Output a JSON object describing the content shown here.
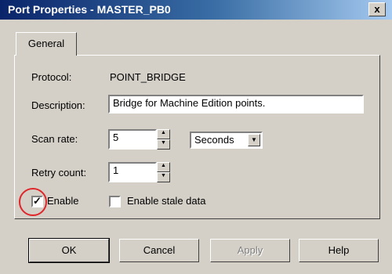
{
  "window": {
    "title": "Port Properties - MASTER_PB0",
    "close_label": "x"
  },
  "tabs": [
    {
      "label": "General"
    }
  ],
  "general": {
    "protocol_label": "Protocol:",
    "protocol_value": "POINT_BRIDGE",
    "description_label": "Description:",
    "description_value": "Bridge for Machine Edition points.",
    "scan_rate_label": "Scan rate:",
    "scan_rate_value": "5",
    "scan_rate_unit": "Seconds",
    "retry_count_label": "Retry count:",
    "retry_count_value": "1",
    "enable_label": "Enable",
    "enable_checked": true,
    "stale_label": "Enable stale data",
    "stale_checked": false
  },
  "buttons": {
    "ok": "OK",
    "cancel": "Cancel",
    "apply": "Apply",
    "help": "Help"
  },
  "colors": {
    "title_start": "#0a246a",
    "title_end": "#a6caf0",
    "face": "#d4d0c8",
    "highlight_ring": "#e0262a"
  }
}
